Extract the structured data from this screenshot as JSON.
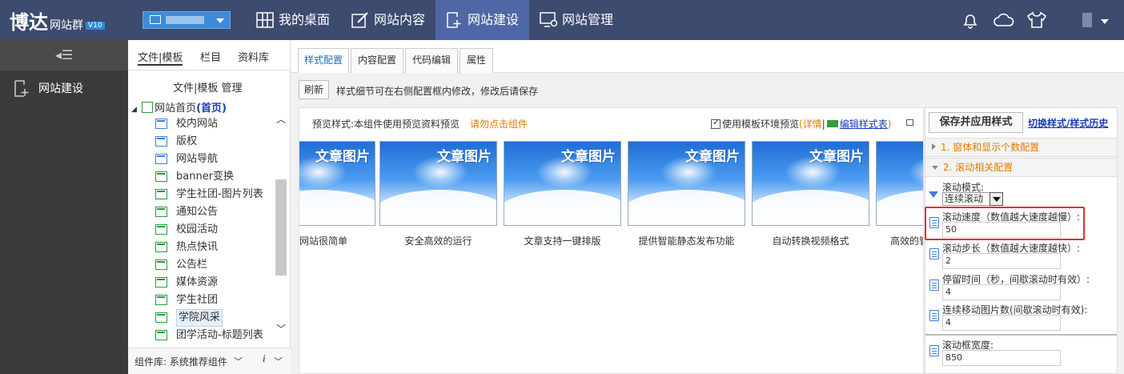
{
  "app": {
    "logo_main": "博达",
    "logo_sub": "网站群",
    "version": "V10"
  },
  "colors": {
    "topbar": "#3c4b6e",
    "active_nav": "#4f67a6",
    "accent_blue": "#1a3cb8",
    "warn_orange": "#e07c00",
    "highlight_red": "#e03030"
  },
  "top_nav": [
    {
      "label": "我的桌面",
      "icon": "desktop-icon"
    },
    {
      "label": "网站内容",
      "icon": "edit-icon"
    },
    {
      "label": "网站建设",
      "icon": "add-page-icon"
    },
    {
      "label": "网站管理",
      "icon": "monitor-settings-icon"
    }
  ],
  "top_icons": [
    "bell-icon",
    "cloud-icon",
    "tshirt-icon",
    "user-menu-icon"
  ],
  "sidebar": {
    "collapse": "◂☰",
    "item": "网站建设"
  },
  "tree": {
    "tabs": [
      "文件|模板",
      "栏目",
      "资料库"
    ],
    "manage": "文件|模板 管理",
    "root_label": "网站首页",
    "root_tag": "(首页)",
    "items": [
      {
        "label": "校内网站",
        "type": "blue"
      },
      {
        "label": "版权",
        "type": "blue"
      },
      {
        "label": "网站导航",
        "type": "blue"
      },
      {
        "label": "banner变换",
        "type": "green"
      },
      {
        "label": "学生社团-图片列表",
        "type": "green"
      },
      {
        "label": "通知公告",
        "type": "green"
      },
      {
        "label": "校园活动",
        "type": "green"
      },
      {
        "label": "热点快讯",
        "type": "green"
      },
      {
        "label": "公告栏",
        "type": "green"
      },
      {
        "label": "媒体资源",
        "type": "green"
      },
      {
        "label": "学生社团",
        "type": "green"
      },
      {
        "label": "学院风采",
        "type": "green"
      },
      {
        "label": "团学活动-标题列表",
        "type": "green"
      }
    ],
    "footer": "组件库: 系统推荐组件"
  },
  "main": {
    "tabs": [
      "样式配置",
      "内容配置",
      "代码编辑",
      "属性"
    ],
    "refresh": "刷新",
    "refresh_hint": "样式细节可在右侧配置框内修改，修改后请保存"
  },
  "preview": {
    "label": "预览样式:本组件使用预览资料预览",
    "warn": "请勿点击组件",
    "checkbox_label": "使用模板环境预览",
    "detail_open": "(",
    "detail": "详情",
    "sep": "|",
    "edit_link": "编辑样式表",
    "detail_close": ")",
    "card_title": "文章图片",
    "captions": [
      "网站很简单",
      "安全高效的运行",
      "文章支持一键排版",
      "提供智能静态发布功能",
      "自动转换视频格式",
      "高效的管"
    ]
  },
  "config": {
    "save": "保存并应用样式",
    "history": "切换样式/样式历史",
    "sections": [
      "1. 窗体和显示个数配置",
      "2. 滚动相关配置"
    ],
    "mode_label": "滚动模式:",
    "mode_value": "连续滚动",
    "fields": [
      {
        "label": "滚动速度（数值越大速度越慢）:",
        "value": "50"
      },
      {
        "label": "滚动步长（数值越大速度越快）:",
        "value": "2"
      },
      {
        "label": "停留时间（秒，间歇滚动时有效）:",
        "value": "4"
      },
      {
        "label": "连续移动图片数(间歇滚动时有效):",
        "value": "4"
      },
      {
        "label": "滚动框宽度:",
        "value": "850"
      }
    ]
  }
}
